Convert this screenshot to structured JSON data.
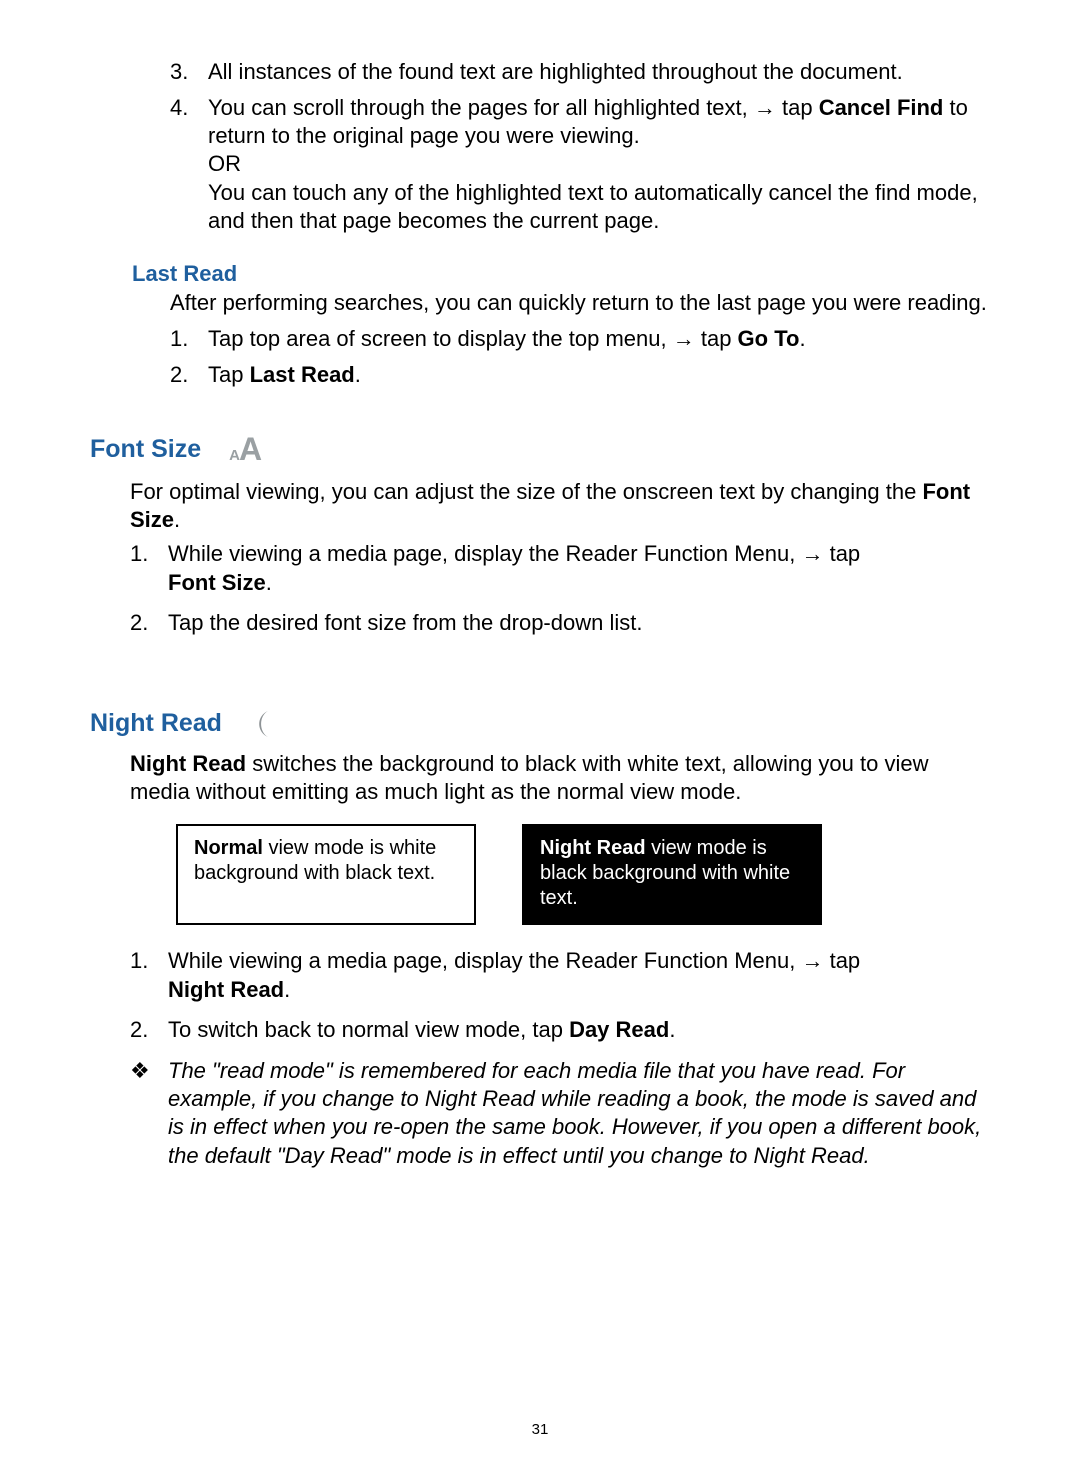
{
  "top_list": {
    "item3": "All instances of the found text are highlighted throughout the document.",
    "item4_a": "You can scroll through the pages for all highlighted text, ",
    "item4_arrow": "→",
    "item4_b": " tap ",
    "item4_bold": "Cancel Find",
    "item4_c": " to return to the original page you were viewing.",
    "item4_or": "OR",
    "item4_d": "You can touch any of the highlighted text to automatically cancel the find mode, and then that page becomes the current page."
  },
  "last_read": {
    "heading": "Last Read",
    "intro": "After performing searches, you can quickly return to the last page you were reading.",
    "step1_a": "Tap top area of screen to display the top menu, ",
    "step1_arrow": "→",
    "step1_b": " tap ",
    "step1_bold": "Go To",
    "step1_c": ".",
    "step2_a": "Tap ",
    "step2_bold": "Last Read",
    "step2_b": "."
  },
  "font_size": {
    "heading": "Font Size",
    "intro_a": "For optimal viewing, you can adjust the size of the onscreen text by changing the ",
    "intro_bold": "Font Size",
    "intro_b": ".",
    "step1_a": "While viewing a media page, display the Reader Function Menu, ",
    "step1_arrow": "→",
    "step1_b": " tap ",
    "step1_bold": "Font Size",
    "step1_c": ".",
    "step2": "Tap the desired font size from the drop-down list."
  },
  "night_read": {
    "heading": "Night Read",
    "intro_bold": "Night Read",
    "intro_a": " switches the background to black with white text, allowing you to view media without emitting as much light as the normal view mode.",
    "box_normal_bold": "Normal",
    "box_normal_rest": " view mode is white background with black text.",
    "box_night_bold": "Night Read",
    "box_night_rest": " view mode is black background with white text.",
    "step1_a": "While viewing a media page, display the Reader Function Menu, ",
    "step1_arrow": "→",
    "step1_b": " tap ",
    "step1_bold": "Night Read",
    "step1_c": ".",
    "step2_a": "To switch back to normal view mode, tap ",
    "step2_bold": "Day Read",
    "step2_b": ".",
    "note": "The \"read mode\" is remembered for each media file that you have read. For example, if you change to Night Read while reading a book, the mode is saved and is in effect when you re-open the same book. However, if you open a different book, the default \"Day Read\" mode is in effect until you change to Night Read."
  },
  "page_number": "31",
  "diamond": "❖"
}
